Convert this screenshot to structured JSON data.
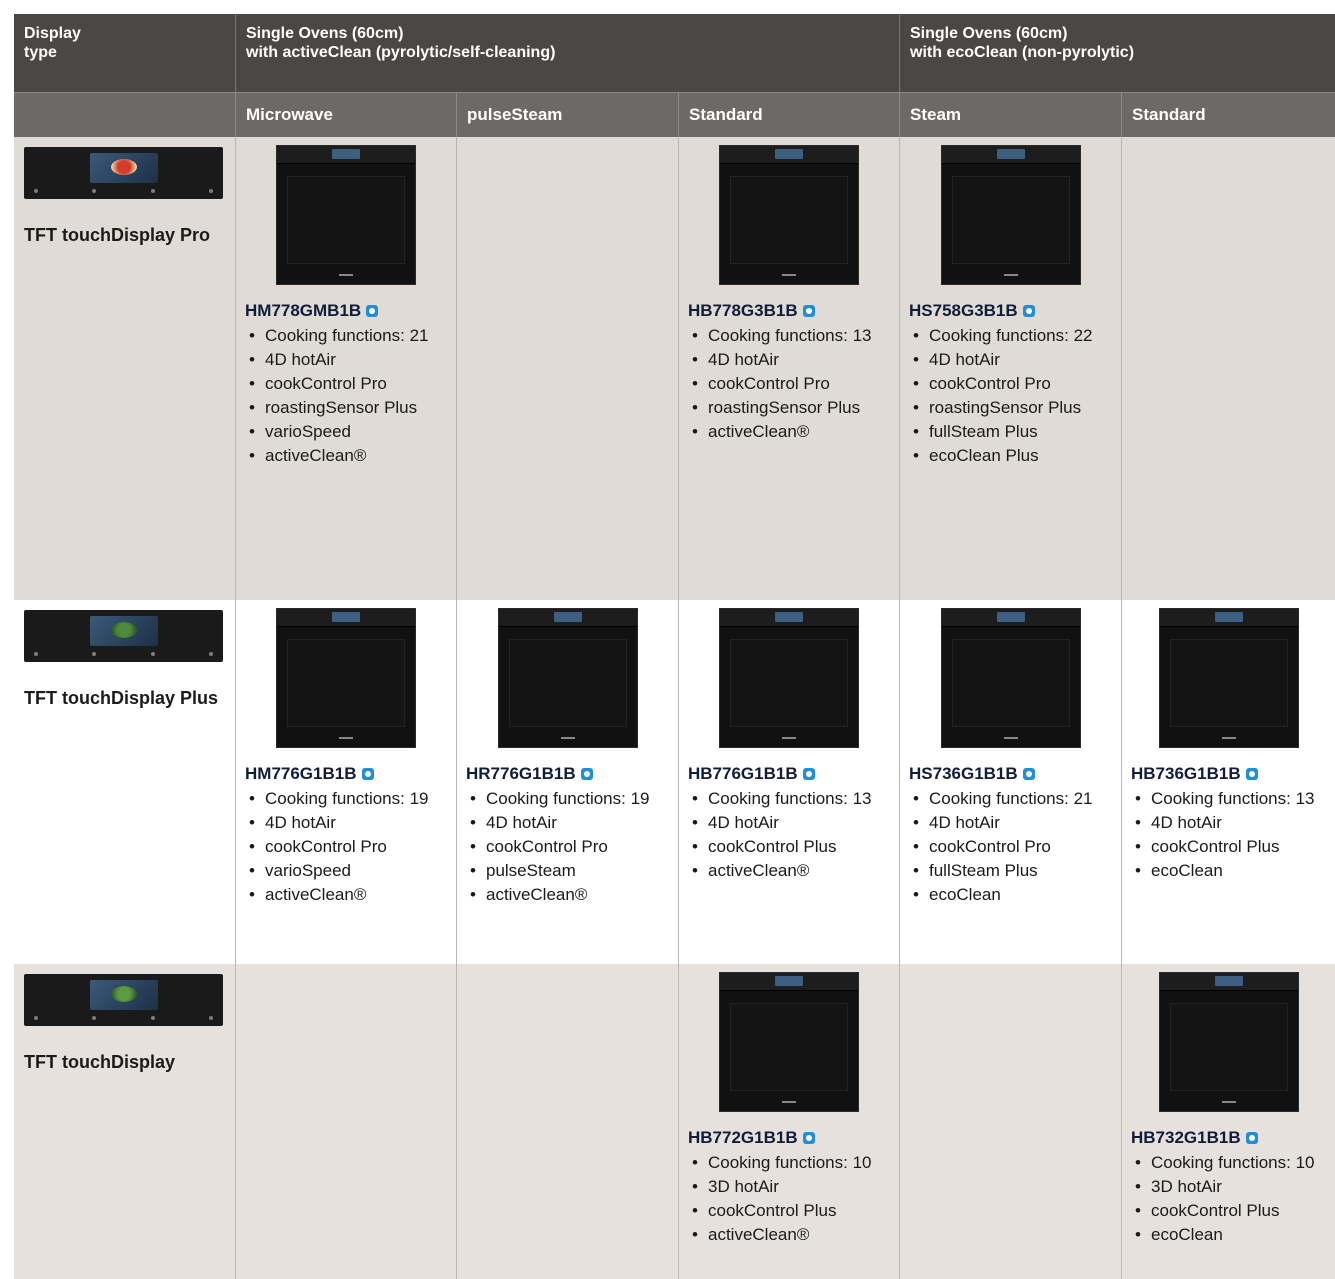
{
  "header": {
    "display_type": "Display\ntype",
    "group_active": "Single Ovens (60cm)\nwith activeClean (pyrolytic/self-cleaning)",
    "group_eco": "Single Ovens (60cm)\nwith ecoClean (non-pyrolytic)"
  },
  "subheader": {
    "microwave": "Microwave",
    "pulsesteam": "pulseSteam",
    "standard_active": "Standard",
    "steam": "Steam",
    "standard_eco": "Standard"
  },
  "rows": {
    "pro": {
      "label": "TFT touchDisplay Pro",
      "products": {
        "microwave": {
          "model": "HM778GMB1B",
          "features": [
            "Cooking functions: 21",
            "4D hotAir",
            "cookControl Pro",
            "roastingSensor Plus",
            "varioSpeed",
            "activeClean®"
          ]
        },
        "standard_active": {
          "model": "HB778G3B1B",
          "features": [
            "Cooking functions: 13",
            "4D hotAir",
            "cookControl Pro",
            "roastingSensor Plus",
            "activeClean®"
          ]
        },
        "steam": {
          "model": "HS758G3B1B",
          "features": [
            "Cooking functions: 22",
            "4D hotAir",
            "cookControl Pro",
            "roastingSensor Plus",
            "fullSteam Plus",
            "ecoClean Plus"
          ]
        }
      }
    },
    "plus": {
      "label": "TFT touchDisplay Plus",
      "products": {
        "microwave": {
          "model": "HM776G1B1B",
          "features": [
            "Cooking functions: 19",
            "4D hotAir",
            "cookControl Pro",
            "varioSpeed",
            "activeClean®"
          ]
        },
        "pulsesteam": {
          "model": "HR776G1B1B",
          "features": [
            "Cooking functions: 19",
            "4D hotAir",
            "cookControl Pro",
            "pulseSteam",
            "activeClean®"
          ]
        },
        "standard_active": {
          "model": "HB776G1B1B",
          "features": [
            "Cooking functions: 13",
            "4D hotAir",
            "cookControl Plus",
            "activeClean®"
          ]
        },
        "steam": {
          "model": "HS736G1B1B",
          "features": [
            "Cooking functions: 21",
            "4D hotAir",
            "cookControl Pro",
            "fullSteam Plus",
            "ecoClean"
          ]
        },
        "standard_eco": {
          "model": "HB736G1B1B",
          "features": [
            "Cooking functions: 13",
            "4D hotAir",
            "cookControl Plus",
            "ecoClean"
          ]
        }
      }
    },
    "std": {
      "label": "TFT touchDisplay",
      "products": {
        "standard_active": {
          "model": "HB772G1B1B",
          "features": [
            "Cooking functions: 10",
            "3D hotAir",
            "cookControl Plus",
            "activeClean®"
          ]
        },
        "standard_eco": {
          "model": "HB732G1B1B",
          "features": [
            "Cooking functions: 10",
            "3D hotAir",
            "cookControl Plus",
            "ecoClean"
          ]
        }
      }
    }
  },
  "icons": {
    "badge": "home-connect-icon",
    "oven": "oven-image",
    "display": "display-panel-image"
  },
  "colors": {
    "header_bg": "#4a4744",
    "subheader_bg": "#6d6966",
    "row_pro_bg": "#e0dbd5",
    "row_plus_bg": "#ffffff",
    "row_std_bg": "#e6e1dc",
    "badge": "#1f8fd9"
  }
}
